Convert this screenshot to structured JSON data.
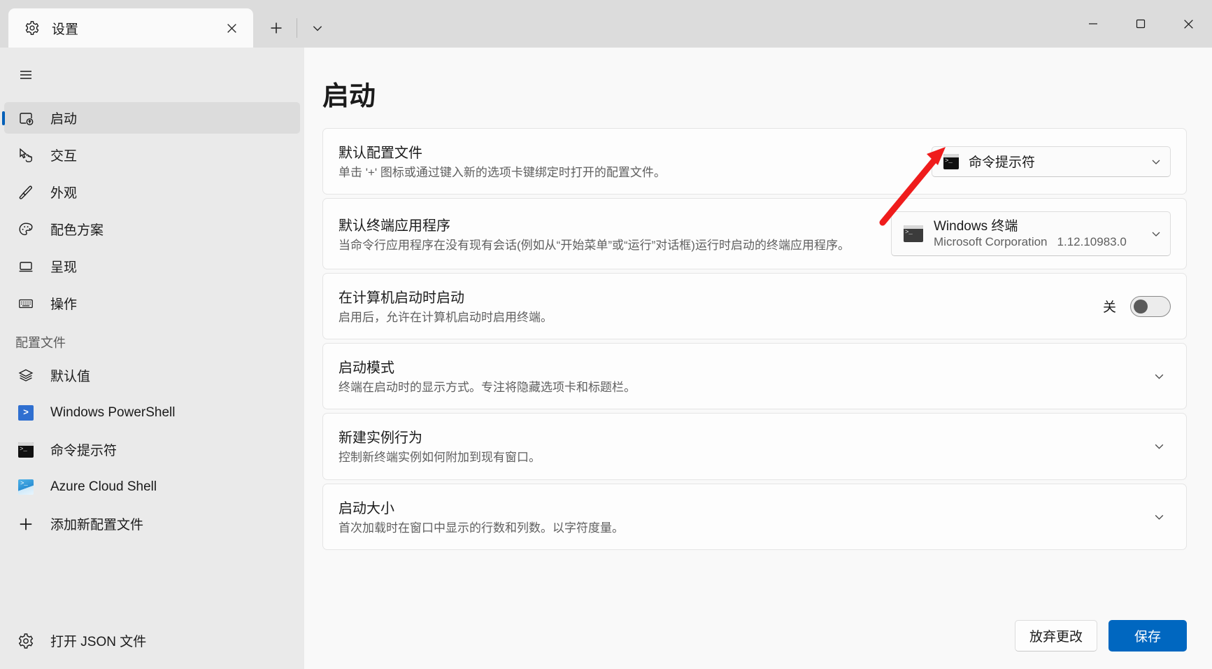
{
  "window": {
    "tab": {
      "title": "设置",
      "icon": "gear-icon",
      "close_icon": "close-icon"
    },
    "new_tab_icon": "plus-icon",
    "tab_dropdown_icon": "chevron-down-icon",
    "controls": {
      "minimize": "minimize-icon",
      "maximize": "maximize-icon",
      "close": "close-icon"
    }
  },
  "nav": {
    "hamburger_icon": "hamburger-icon",
    "items": [
      {
        "label": "启动",
        "icon": "launch-icon",
        "selected": true
      },
      {
        "label": "交互",
        "icon": "cursor-hand-icon",
        "selected": false
      },
      {
        "label": "外观",
        "icon": "paintbrush-icon",
        "selected": false
      },
      {
        "label": "配色方案",
        "icon": "palette-icon",
        "selected": false
      },
      {
        "label": "呈现",
        "icon": "monitor-icon",
        "selected": false
      },
      {
        "label": "操作",
        "icon": "keyboard-icon",
        "selected": false
      }
    ],
    "section_label": "配置文件",
    "profiles": [
      {
        "label": "默认值",
        "icon": "layers-icon"
      },
      {
        "label": "Windows PowerShell",
        "icon": "powershell-icon"
      },
      {
        "label": "命令提示符",
        "icon": "command-prompt-icon"
      },
      {
        "label": "Azure Cloud Shell",
        "icon": "azure-cloud-shell-icon"
      },
      {
        "label": "添加新配置文件",
        "icon": "plus-icon"
      }
    ],
    "open_json": {
      "label": "打开 JSON 文件",
      "icon": "gear-icon"
    }
  },
  "main": {
    "page_title": "启动",
    "cards": [
      {
        "title": "默认配置文件",
        "desc": "单击 '+' 图标或通过键入新的选项卡键绑定时打开的配置文件。",
        "control": "combo",
        "combo_value": "命令提示符",
        "combo_icon": "command-prompt-icon"
      },
      {
        "title": "默认终端应用程序",
        "desc": "当命令行应用程序在没有现有会话(例如从“开始菜单”或“运行”对话框)运行时启动的终端应用程序。",
        "control": "combo-tall",
        "combo_value": "Windows 终端",
        "combo_publisher": "Microsoft Corporation",
        "combo_version": "1.12.10983.0",
        "combo_icon": "windows-terminal-icon"
      },
      {
        "title": "在计算机启动时启动",
        "desc": "启用后，允许在计算机启动时启用终端。",
        "control": "toggle",
        "toggle_label": "关",
        "toggle_on": false
      },
      {
        "title": "启动模式",
        "desc": "终端在启动时的显示方式。专注将隐藏选项卡和标题栏。",
        "control": "expander"
      },
      {
        "title": "新建实例行为",
        "desc": "控制新终端实例如何附加到现有窗口。",
        "control": "expander"
      },
      {
        "title": "启动大小",
        "desc": "首次加载时在窗口中显示的行数和列数。以字符度量。",
        "control": "expander"
      }
    ]
  },
  "footer": {
    "discard_label": "放弃更改",
    "save_label": "保存"
  },
  "annotation": {
    "arrow_color": "#ef1c1c",
    "arrow_label": "red-arrow-pointing-to-default-profile-dropdown"
  },
  "colors": {
    "accent": "#0067c0",
    "selection_indicator": "#005fb8",
    "titlebar": "#dcdcdc",
    "nav_bg": "#eaeaea",
    "main_bg": "#f9f9f9",
    "card_bg": "#fdfdfd"
  }
}
